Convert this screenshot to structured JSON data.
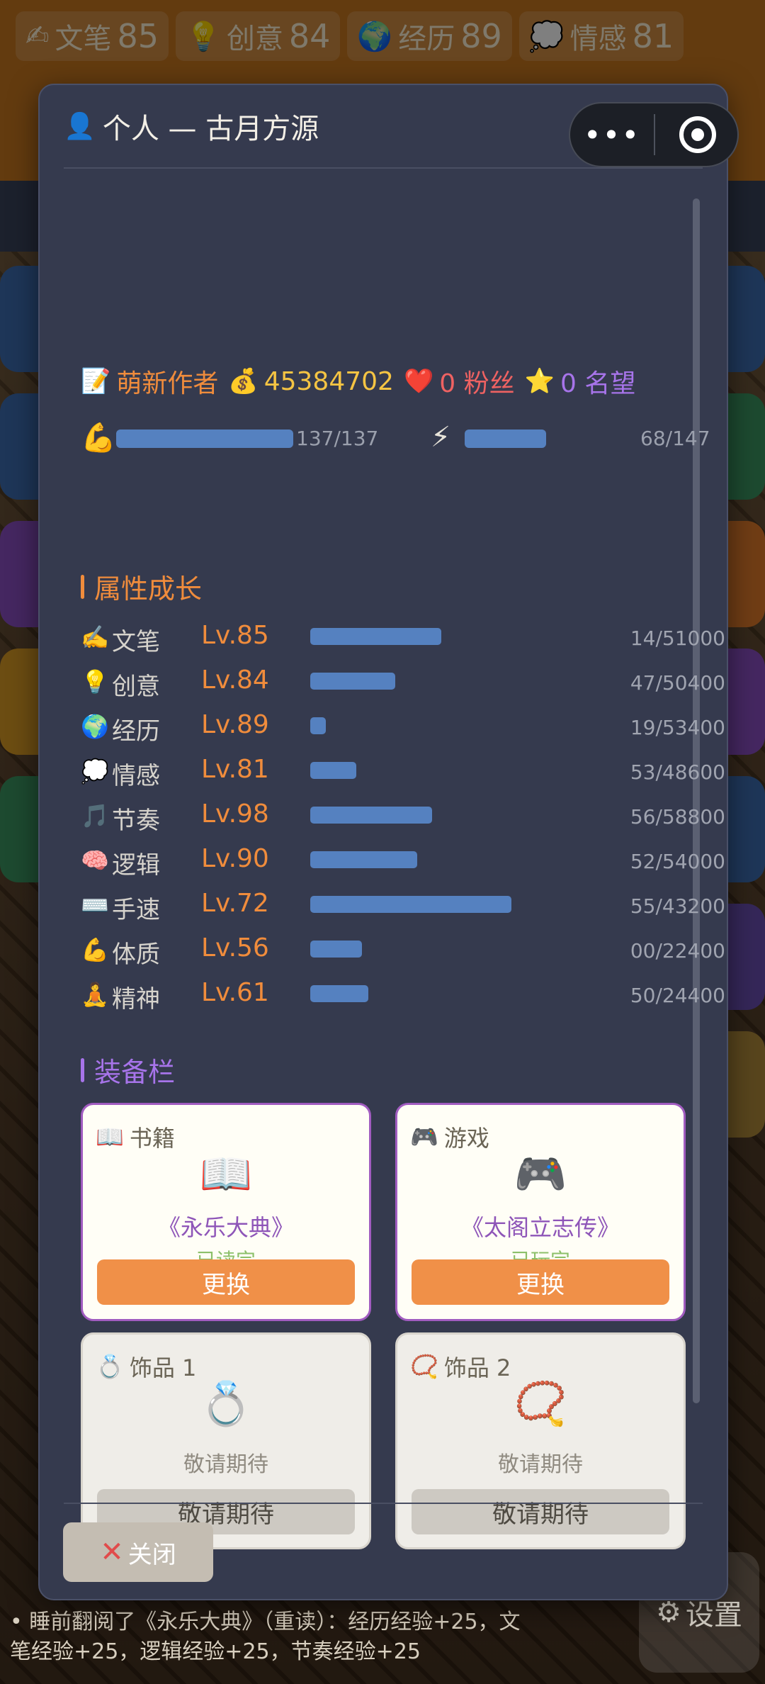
{
  "background": {
    "stats": [
      {
        "icon": "✍",
        "name": "文笔",
        "value": "85"
      },
      {
        "icon": "💡",
        "name": "创意",
        "value": "84"
      },
      {
        "icon": "🌍",
        "name": "经历",
        "value": "89"
      },
      {
        "icon": "💭",
        "name": "情感",
        "value": "81"
      }
    ],
    "log_line_1": "• 睡前翻阅了《永乐大典》（重读）：经历经验+25，文",
    "log_line_2": "笔经验+25，逻辑经验+25，节奏经验+25",
    "settings_label": "设置"
  },
  "capsule": {
    "more_label": "•••"
  },
  "modal": {
    "title_icon": "👤",
    "title": "个人 — 古月方源",
    "summary": {
      "rank_icon": "📝",
      "rank": "萌新作者",
      "money_icon": "💰",
      "money": "45384702",
      "fans_icon": "❤️",
      "fans": "0 粉丝",
      "fame_icon": "⭐",
      "fame": "0 名望"
    },
    "vitals": {
      "stamina_icon": "💪",
      "stamina_text": "137/137",
      "stamina_fraction": 1.0,
      "energy_icon": "⚡",
      "energy_text": "68/147",
      "energy_fraction": 0.46
    },
    "attributes_title": "属性成长",
    "attributes": [
      {
        "icon": "✍️",
        "name": "文笔",
        "level": "Lv.85",
        "exp": "14/51000",
        "fraction": 0.43
      },
      {
        "icon": "💡",
        "name": "创意",
        "level": "Lv.84",
        "exp": "47/50400",
        "fraction": 0.28
      },
      {
        "icon": "🌍",
        "name": "经历",
        "level": "Lv.89",
        "exp": "19/53400",
        "fraction": 0.05
      },
      {
        "icon": "💭",
        "name": "情感",
        "level": "Lv.81",
        "exp": "53/48600",
        "fraction": 0.15
      },
      {
        "icon": "🎵",
        "name": "节奏",
        "level": "Lv.98",
        "exp": "56/58800",
        "fraction": 0.4
      },
      {
        "icon": "🧠",
        "name": "逻辑",
        "level": "Lv.90",
        "exp": "52/54000",
        "fraction": 0.35
      },
      {
        "icon": "⌨️",
        "name": "手速",
        "level": "Lv.72",
        "exp": "55/43200",
        "fraction": 0.66
      },
      {
        "icon": "💪",
        "name": "体质",
        "level": "Lv.56",
        "exp": "00/22400",
        "fraction": 0.17
      },
      {
        "icon": "🧘",
        "name": "精神",
        "level": "Lv.61",
        "exp": "50/24400",
        "fraction": 0.19
      }
    ],
    "equipment_title": "装备栏",
    "equipment": [
      {
        "slot_icon": "📖",
        "slot": "书籍",
        "item_icon": "📖",
        "item_name": "《永乐大典》",
        "status": "已读完",
        "button": "更换"
      },
      {
        "slot_icon": "🎮",
        "slot": "游戏",
        "item_icon": "🎮",
        "item_name": "《太阁立志传》",
        "status": "已玩完",
        "button": "更换"
      },
      {
        "slot_icon": "💍",
        "slot": "饰品 1",
        "item_icon": "💍",
        "placeholder": "敬请期待",
        "button": "敬请期待"
      },
      {
        "slot_icon": "📿",
        "slot": "饰品 2",
        "item_icon": "📿",
        "placeholder": "敬请期待",
        "button": "敬请期待"
      }
    ],
    "close_icon": "✕",
    "close_label": "关闭"
  },
  "colors": {
    "accent_orange": "#f08c3c",
    "bar_blue": "#5581c0",
    "fans_red": "#ef6262",
    "fame_purple": "#a774ea",
    "modal_bg": "#353a4e"
  }
}
